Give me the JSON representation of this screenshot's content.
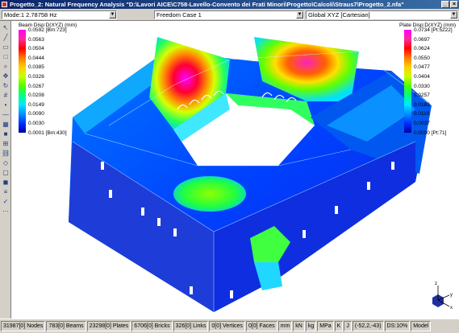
{
  "window": {
    "title": "Progetto_2: Natural Frequency Analysis \"D:\\Lavori AICE\\C758-Lavello-Convento dei Frati Minori\\Progetto\\Calcoli\\Straus7\\Progetto_2.nfa\"",
    "controls": [
      "_",
      "×"
    ]
  },
  "toolbar": {
    "mode": "Mode:1  2.78758 Hz",
    "case": "Freedom Case 1",
    "coord": "Global XYZ [Cartesian]"
  },
  "left_tools": [
    "pointer-tool-icon",
    "line-tool-icon",
    "select-tool-icon",
    "box-tool-icon",
    "zoom-tool-icon",
    "pan-tool-icon",
    "rotate-tool-icon",
    "grid-tool-icon",
    "node-tool-icon",
    "beam-tool-icon",
    "plate-tool-icon",
    "brick-tool-icon",
    "mesh-tool-icon",
    "link-tool-icon",
    "vertex-tool-icon",
    "face-tool-icon",
    "solid-tool-icon",
    "result-tool-icon",
    "check-tool-icon",
    "misc-tool-icon"
  ],
  "beam_legend": {
    "title": "Beam Disp:D(XYZ) (mm)",
    "labels": [
      "0.0592 [Bm:723]",
      "0.0563",
      "0.0504",
      "0.0444",
      "0.0385",
      "0.0326",
      "0.0267",
      "0.0208",
      "0.0149",
      "0.0090",
      "0.0030",
      "0.0001 [Bm:430]"
    ],
    "colors": [
      "#ff00ff",
      "#ff2a9a",
      "#ff0000",
      "#ff7a00",
      "#ffd000",
      "#c8ff00",
      "#4cff00",
      "#00ff80",
      "#00e8ff",
      "#0090ff",
      "#0030ff",
      "#0000a0"
    ]
  },
  "plate_legend": {
    "title": "Plate Disp:D(XYZ) (mm)",
    "labels": [
      "0.0734 [Pt:5222]",
      "0.0697",
      "0.0624",
      "0.0550",
      "0.0477",
      "0.0404",
      "0.0330",
      "0.0257",
      "0.0183",
      "0.0110",
      "0.0037",
      "0.0000 [Pt:71]"
    ],
    "colors": [
      "#ff00ff",
      "#ff2a9a",
      "#ff0000",
      "#ff7a00",
      "#ffd000",
      "#c8ff00",
      "#4cff00",
      "#00ff80",
      "#00e8ff",
      "#0090ff",
      "#0030ff",
      "#0000a0"
    ]
  },
  "status": {
    "items": [
      "31987[0] Nodes",
      "783[0] Beams",
      "23298[0] Plates",
      "6706[0] Bricks",
      "326[0] Links",
      "0[0] Vertices",
      "0[0] Faces",
      "mm",
      "kN",
      "kg",
      "MPa",
      "K",
      "J",
      "(-52,2,-43)",
      "DS:10%",
      "Model"
    ]
  },
  "axis": {
    "x": "x",
    "y": "y",
    "z": "z"
  }
}
